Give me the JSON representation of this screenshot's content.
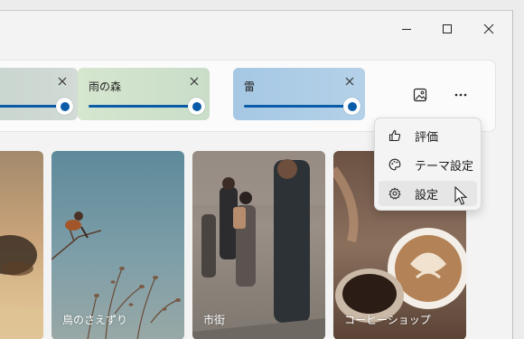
{
  "colors": {
    "accent": "#0a5ba8",
    "menu_hover": "#e6e6e6"
  },
  "sounds": [
    {
      "label": "",
      "volume": 1.0,
      "tint": "#c9d6cf",
      "close_icon": "close-icon"
    },
    {
      "label": "雨の森",
      "volume": 1.0,
      "tint": "#cfe2cc",
      "close_icon": "close-icon"
    },
    {
      "label": "雷",
      "volume": 1.0,
      "tint": "#a9cbe6",
      "close_icon": "close-icon"
    }
  ],
  "toolbar": {
    "wallpaper_icon": "image-icon",
    "more_icon": "more-icon"
  },
  "tiles": [
    {
      "caption": ""
    },
    {
      "caption": "鳥のさえずり"
    },
    {
      "caption": "市街"
    },
    {
      "caption": "コーヒーショップ"
    }
  ],
  "context_menu": {
    "items": [
      {
        "label": "評価",
        "icon": "thumbs-up-icon"
      },
      {
        "label": "テーマ設定",
        "icon": "palette-icon"
      },
      {
        "label": "設定",
        "icon": "gear-icon",
        "hovered": true
      }
    ]
  }
}
